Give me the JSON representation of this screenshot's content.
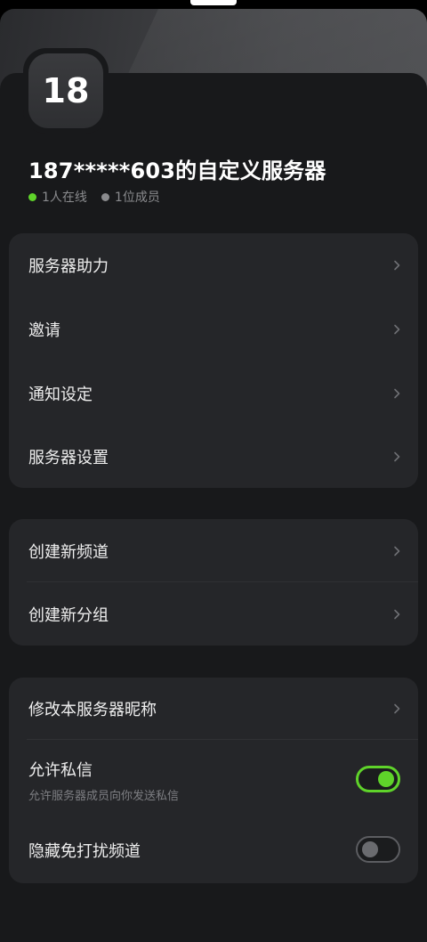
{
  "server": {
    "avatar_text": "18",
    "name": "187*****603的自定义服务器",
    "online": "1人在线",
    "members": "1位成员"
  },
  "groups": [
    {
      "items": [
        {
          "label": "服务器助力"
        },
        {
          "label": "邀请"
        },
        {
          "label": "通知设定"
        },
        {
          "label": "服务器设置"
        }
      ]
    },
    {
      "items": [
        {
          "label": "创建新频道"
        },
        {
          "label": "创建新分组"
        }
      ]
    },
    {
      "items": [
        {
          "label": "修改本服务器昵称"
        },
        {
          "label": "允许私信",
          "sublabel": "允许服务器成员向你发送私信",
          "toggle": "on"
        },
        {
          "label": "隐藏免打扰频道",
          "toggle": "off"
        }
      ]
    }
  ],
  "colors": {
    "accent_green": "#5fd32a",
    "sheet_bg": "#18191b",
    "card_bg": "#252629"
  },
  "icons": [
    "chevron-right-icon",
    "online-dot-icon",
    "member-dot-icon"
  ]
}
